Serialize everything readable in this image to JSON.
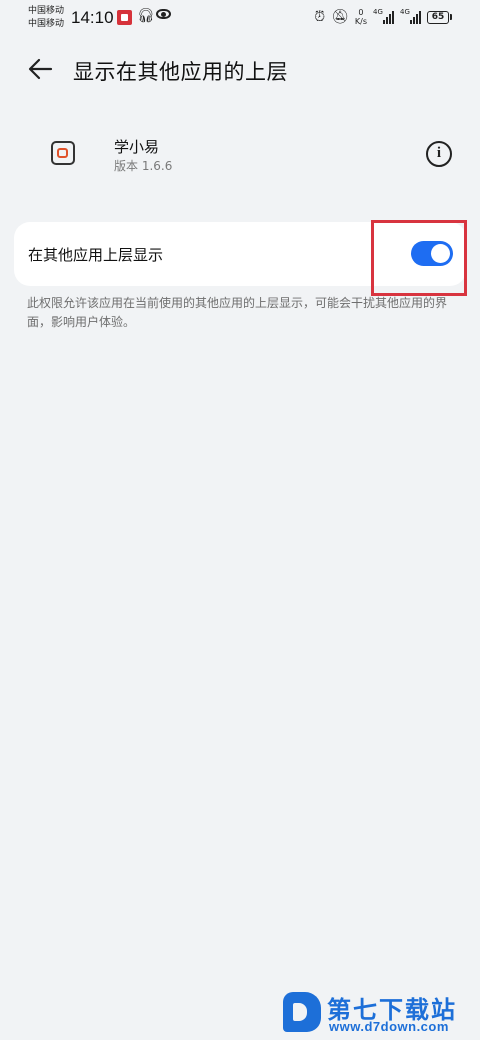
{
  "status_bar": {
    "carrier_line1": "中国移动",
    "carrier_line2": "中国移动",
    "time": "14:10",
    "speed_value": "0",
    "speed_unit": "K/s",
    "net1": "4G",
    "net2": "4G",
    "battery": "65",
    "icons": [
      "app-notification-icon",
      "headphone-icon",
      "eye-icon",
      "alarm-icon",
      "mute-icon",
      "signal-icon",
      "battery-icon"
    ]
  },
  "header": {
    "title": "显示在其他应用的上层"
  },
  "app": {
    "name": "学小易",
    "version": "版本 1.6.6"
  },
  "setting": {
    "label": "在其他应用上层显示",
    "enabled": true,
    "accent_color": "#1e6df2"
  },
  "description": "此权限允许该应用在当前使用的其他应用的上层显示，可能会干扰其他应用的界面，影响用户体验。",
  "watermark": {
    "name": "第七下载站",
    "url": "www.d7down.com"
  },
  "colors": {
    "background": "#f1f3f5",
    "highlight": "#d8343f"
  }
}
